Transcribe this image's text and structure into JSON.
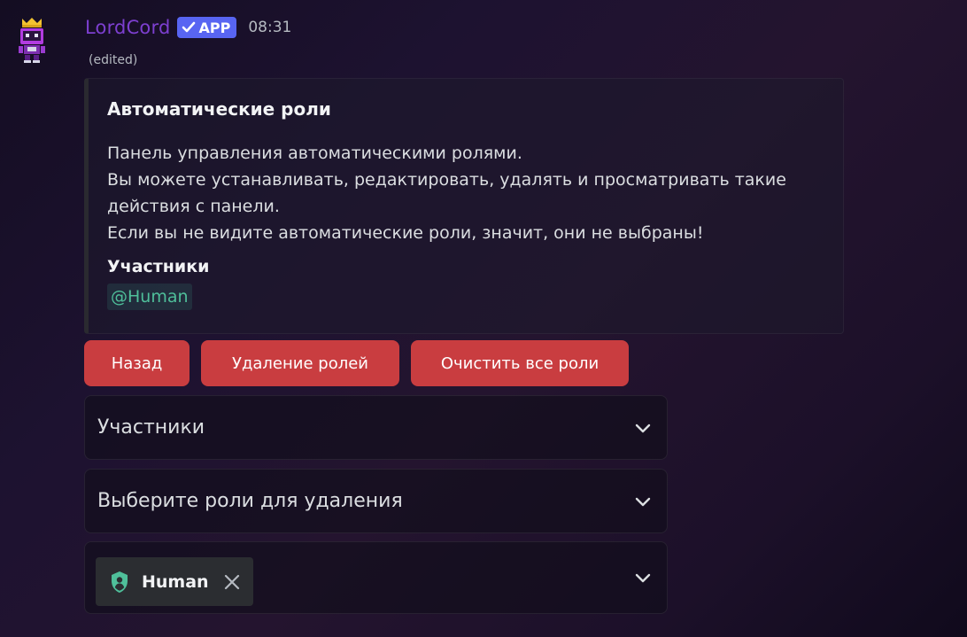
{
  "message": {
    "author": "LordCord",
    "badge": "APP",
    "time": "08:31",
    "edited": "(edited)"
  },
  "embed": {
    "title": "Автоматические роли",
    "description_lines": [
      "Панель управления автоматическими ролями.",
      "Вы можете устанавливать, редактировать, удалять и просматривать такие",
      "действия с панели.",
      "Если вы не видите автоматические роли, значит, они не выбраны!"
    ],
    "field_name": "Участники",
    "field_value": "@Human"
  },
  "buttons": {
    "back": "Назад",
    "delete_roles": "Удаление ролей",
    "clear_all": "Очистить все роли"
  },
  "selects": {
    "members": "Участники",
    "choose_delete": "Выберите роли для удаления",
    "selected_role": "Human"
  },
  "colors": {
    "username": "#7d3fd0",
    "badge": "#5865f2",
    "danger_button": "#c93d40",
    "mention": "#4fbf9a"
  },
  "icons": {
    "avatar": "crowned-robot-avatar",
    "badge": "check-icon",
    "role": "shield-user-icon",
    "remove": "close-icon",
    "dropdown": "chevron-down-icon"
  }
}
